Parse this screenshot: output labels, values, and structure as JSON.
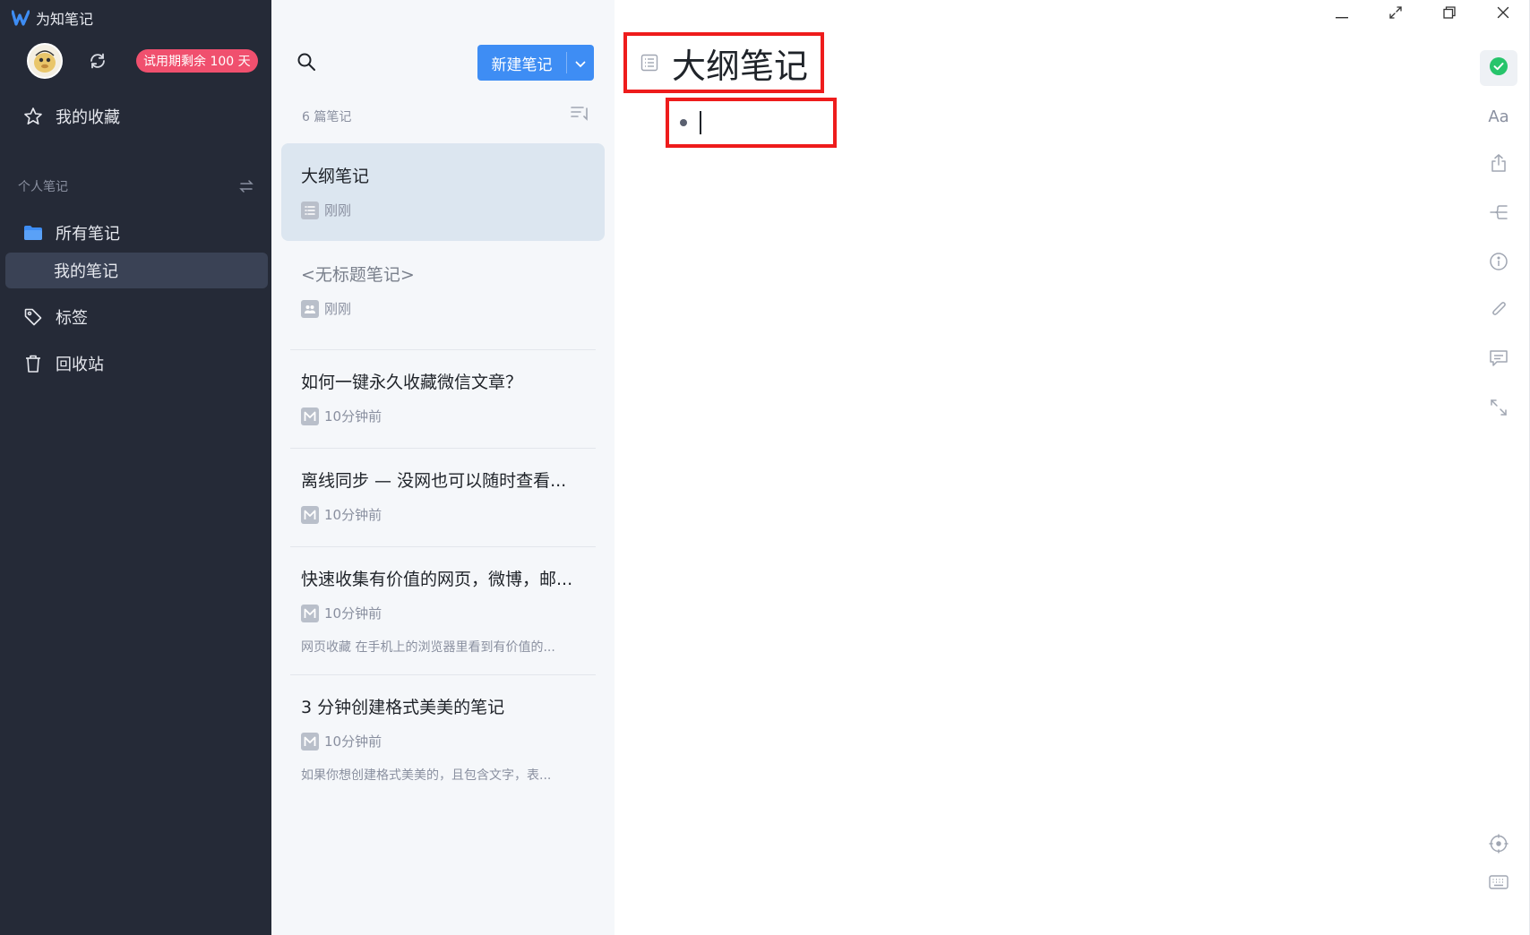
{
  "app": {
    "title": "为知笔记"
  },
  "sidebar": {
    "trial_badge": "试用期剩余 100 天",
    "favorites": "我的收藏",
    "section_title": "个人笔记",
    "all_notes": "所有笔记",
    "my_notes": "我的笔记",
    "tags": "标签",
    "trash": "回收站"
  },
  "notelist": {
    "new_note_label": "新建笔记",
    "count": "6 篇笔记",
    "notes": [
      {
        "title": "大纲笔记",
        "time": "刚刚",
        "type": "outline-icon",
        "snippet": ""
      },
      {
        "title": "<无标题笔记>",
        "time": "刚刚",
        "type": "collab-icon",
        "snippet": ""
      },
      {
        "title": "如何一键永久收藏微信文章？",
        "time": "10分钟前",
        "type": "markdown-icon",
        "snippet": ""
      },
      {
        "title": "离线同步 — 没网也可以随时查看...",
        "time": "10分钟前",
        "type": "markdown-icon",
        "snippet": ""
      },
      {
        "title": "快速收集有价值的网页，微博，邮...",
        "time": "10分钟前",
        "type": "markdown-icon",
        "snippet": "网页收藏 在手机上的浏览器里看到有价值的..."
      },
      {
        "title": "3 分钟创建格式美美的笔记",
        "time": "10分钟前",
        "type": "markdown-icon",
        "snippet": "如果你想创建格式美美的，且包含文字，表..."
      }
    ]
  },
  "editor": {
    "title": "大纲笔记",
    "font_button": "Aa"
  },
  "colors": {
    "sidebar_bg": "#252a37",
    "accent": "#3e8df4",
    "trial_badge": "#f0506e",
    "highlight_box": "#ee1c1c",
    "saved_check": "#27c46b"
  }
}
